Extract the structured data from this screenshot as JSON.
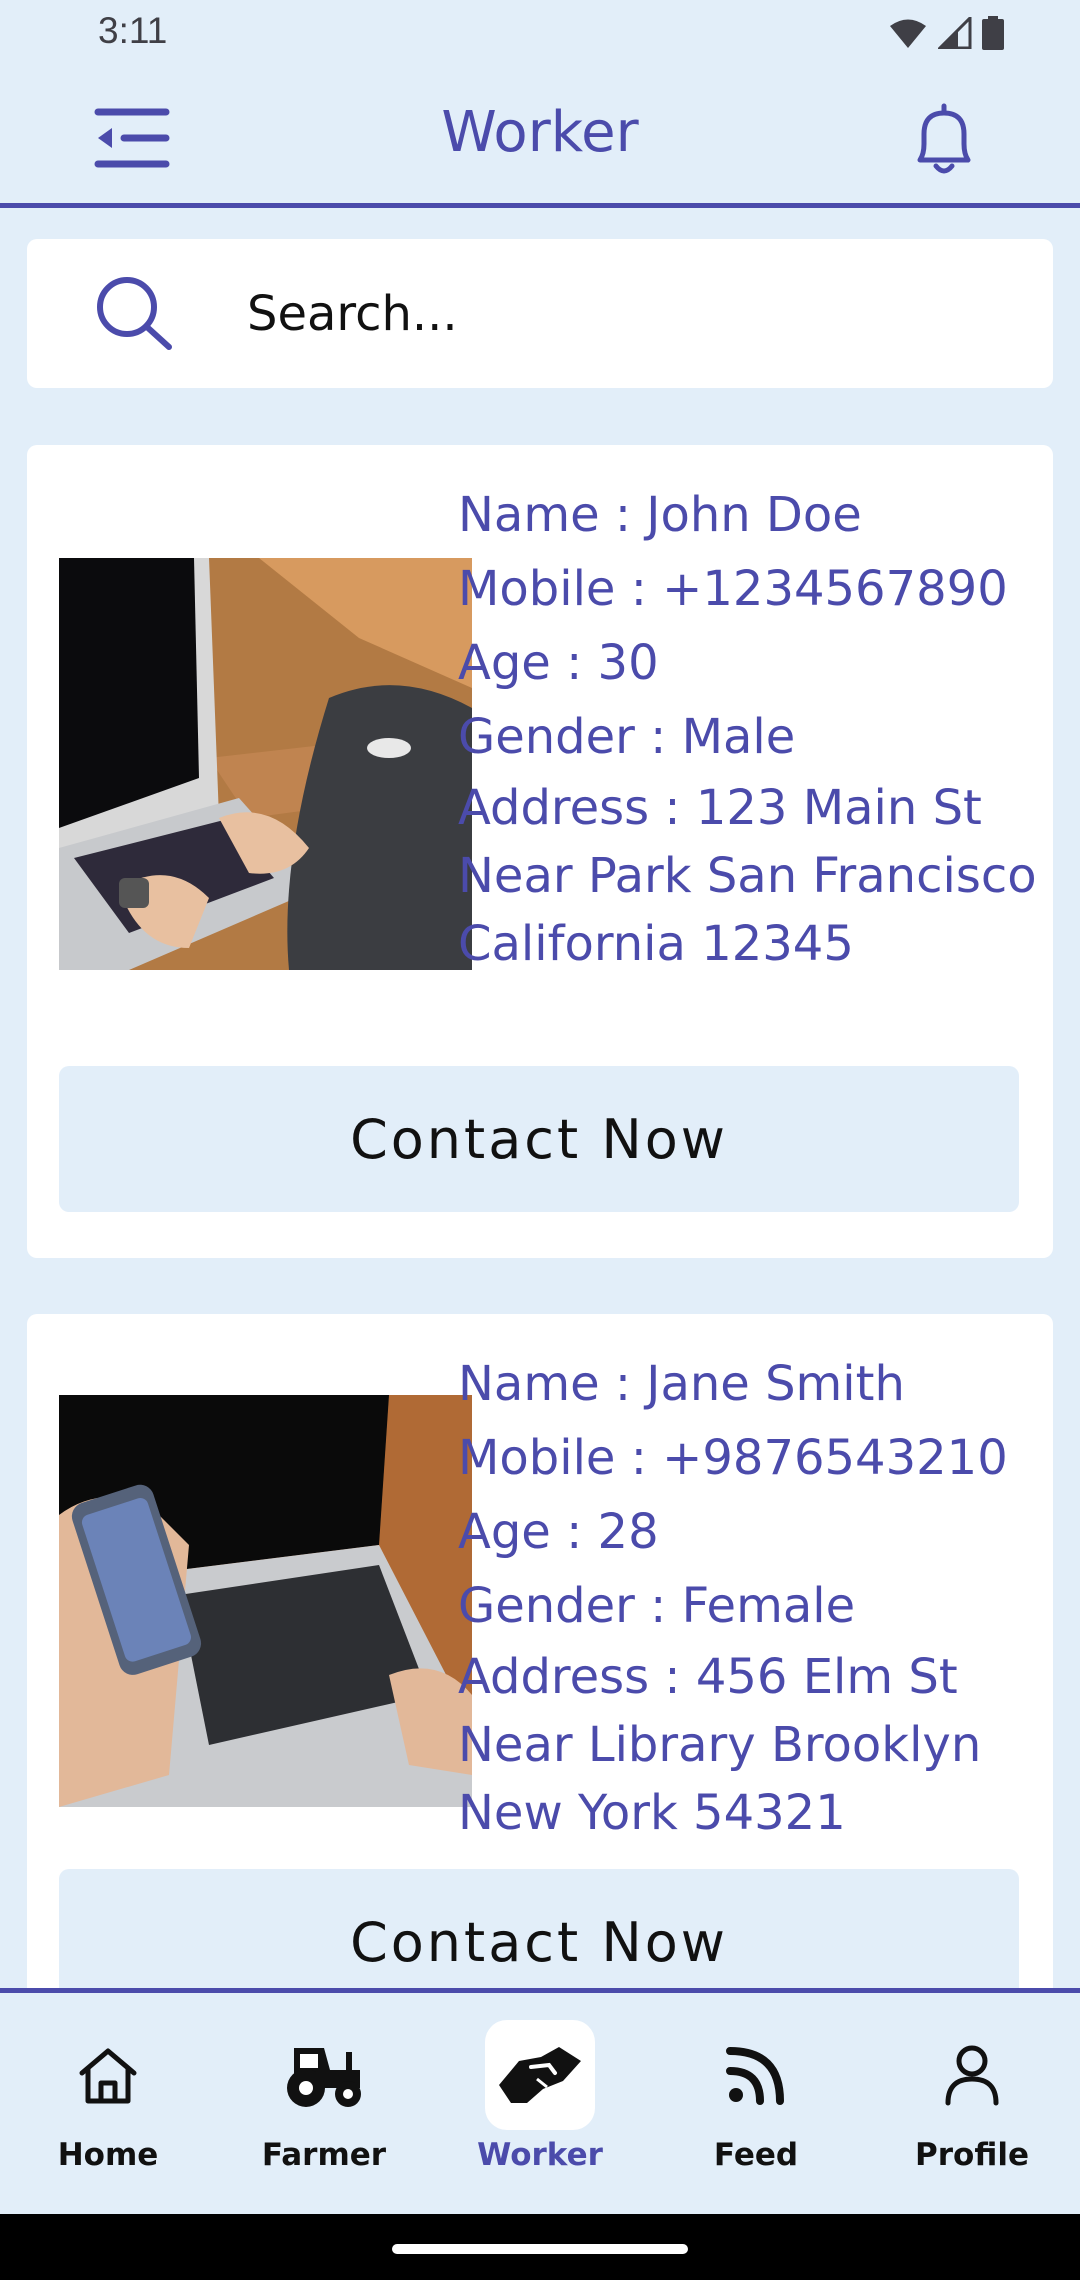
{
  "status_bar": {
    "time": "3:11"
  },
  "app_bar": {
    "title": "Worker"
  },
  "search": {
    "placeholder": "Search..."
  },
  "workers": [
    {
      "name": "Name : John Doe",
      "mobile": "Mobile : +1234567890",
      "age": "Age : 30",
      "gender": "Gender : Male",
      "address": "Address : 123 Main St Near Park San Francisco California 12345",
      "contact_label": "Contact Now"
    },
    {
      "name": "Name : Jane Smith",
      "mobile": "Mobile : +9876543210",
      "age": "Age : 28",
      "gender": "Gender : Female",
      "address": "Address : 456 Elm St Near Library Brooklyn New York 54321",
      "contact_label": "Contact Now"
    }
  ],
  "nav": {
    "items": [
      {
        "label": "Home",
        "icon": "home-icon"
      },
      {
        "label": "Farmer",
        "icon": "tractor-icon"
      },
      {
        "label": "Worker",
        "icon": "handshake-icon"
      },
      {
        "label": "Feed",
        "icon": "rss-icon"
      },
      {
        "label": "Profile",
        "icon": "user-icon"
      }
    ],
    "active": "Worker"
  },
  "colors": {
    "accent": "#4b4bab",
    "background": "#e2eef9",
    "card": "#ffffff"
  }
}
